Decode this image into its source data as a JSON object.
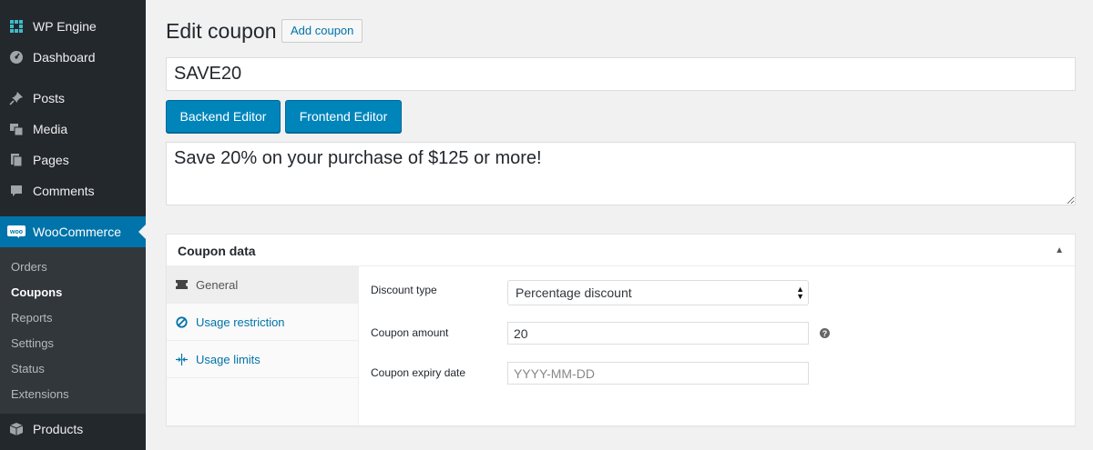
{
  "sidebar": {
    "items": [
      {
        "label": "WP Engine",
        "icon": "wpengine-icon"
      },
      {
        "label": "Dashboard",
        "icon": "dashboard-icon"
      },
      {
        "label": "Posts",
        "icon": "pin-icon"
      },
      {
        "label": "Media",
        "icon": "media-icon"
      },
      {
        "label": "Pages",
        "icon": "pages-icon"
      },
      {
        "label": "Comments",
        "icon": "comments-icon"
      },
      {
        "label": "WooCommerce",
        "icon": "woocommerce-icon"
      },
      {
        "label": "Products",
        "icon": "products-icon"
      }
    ],
    "submenu": [
      "Orders",
      "Coupons",
      "Reports",
      "Settings",
      "Status",
      "Extensions"
    ],
    "current_submenu": "Coupons",
    "accent_color": "#0073aa"
  },
  "header": {
    "title": "Edit coupon",
    "add_button": "Add coupon"
  },
  "coupon": {
    "code": "SAVE20",
    "description": "Save 20% on your purchase of $125 or more!"
  },
  "editor_buttons": {
    "backend": "Backend Editor",
    "frontend": "Frontend Editor"
  },
  "coupon_data": {
    "title": "Coupon data",
    "tabs": [
      {
        "label": "General",
        "icon": "ticket-icon",
        "active": true
      },
      {
        "label": "Usage restriction",
        "icon": "block-icon",
        "active": false
      },
      {
        "label": "Usage limits",
        "icon": "limits-icon",
        "active": false
      }
    ],
    "fields": {
      "discount_type": {
        "label": "Discount type",
        "value": "Percentage discount"
      },
      "coupon_amount": {
        "label": "Coupon amount",
        "value": "20"
      },
      "expiry_date": {
        "label": "Coupon expiry date",
        "placeholder": "YYYY-MM-DD"
      }
    }
  }
}
